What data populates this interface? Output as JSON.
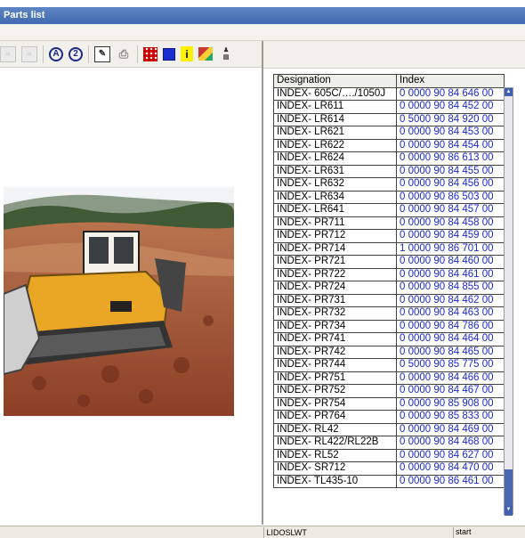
{
  "window": {
    "title": "Parts list"
  },
  "toolbar": {
    "icons": [
      "page-icon",
      "page-icon",
      "circle-a-icon",
      "circle-2-icon",
      "edit-icon",
      "print-icon",
      "grid-icon",
      "blue-square-icon",
      "info-icon",
      "book-icon",
      "library-icon"
    ],
    "circle_a": "A",
    "circle_2": "2",
    "info": "i"
  },
  "table": {
    "headers": [
      "Designation",
      "Index"
    ],
    "rows": [
      [
        "INDEX- 605C/…./1050J",
        "0 0000  90 84 646 00"
      ],
      [
        "INDEX- LR611",
        "0 0000  90 84 452 00"
      ],
      [
        "INDEX- LR614",
        "0 5000  90 84 920 00"
      ],
      [
        "INDEX- LR621",
        "0 0000  90 84 453 00"
      ],
      [
        "INDEX- LR622",
        "0 0000  90 84 454 00"
      ],
      [
        "INDEX- LR624",
        "0 0000  90 86 613 00"
      ],
      [
        "INDEX- LR631",
        "0 0000  90 84 455 00"
      ],
      [
        "INDEX- LR632",
        "0 0000  90 84 456 00"
      ],
      [
        "INDEX- LR634",
        "0 0000  90 86 503 00"
      ],
      [
        "INDEX- LR641",
        "0 0000  90 84 457 00"
      ],
      [
        "INDEX- PR711",
        "0 0000  90 84 458 00"
      ],
      [
        "INDEX- PR712",
        "0 0000  90 84 459 00"
      ],
      [
        "INDEX- PR714",
        "1 0000  90 86 701 00"
      ],
      [
        "INDEX- PR721",
        "0 0000  90 84 460 00"
      ],
      [
        "INDEX- PR722",
        "0 0000  90 84 461 00"
      ],
      [
        "INDEX- PR724",
        "0 0000  90 84 855 00"
      ],
      [
        "INDEX- PR731",
        "0 0000  90 84 462 00"
      ],
      [
        "INDEX- PR732",
        "0 0000  90 84 463 00"
      ],
      [
        "INDEX- PR734",
        "0 0000  90 84 786 00"
      ],
      [
        "INDEX- PR741",
        "0 0000  90 84 464 00"
      ],
      [
        "INDEX- PR742",
        "0 0000  90 84 465 00"
      ],
      [
        "INDEX- PR744",
        "0 5000  90 85 775 00"
      ],
      [
        "INDEX- PR751",
        "0 0000  90 84 466 00"
      ],
      [
        "INDEX- PR752",
        "0 0000  90 84 467 00"
      ],
      [
        "INDEX- PR754",
        "0 0000  90 85 908 00"
      ],
      [
        "INDEX- PR764",
        "0 0000  90 85 833 00"
      ],
      [
        "INDEX- RL42",
        "0 0000  90 84 469 00"
      ],
      [
        "INDEX- RL422/RL22B",
        "0 0000  90 84 468 00"
      ],
      [
        "INDEX- RL52",
        "0 0000  90 84 627 00"
      ],
      [
        "INDEX- SR712",
        "0 0000  90 84 470 00"
      ],
      [
        "INDEX- TL435-10",
        "0 0000  90 86 461 00"
      ]
    ]
  },
  "status": {
    "app": "LIDOSLWT",
    "right": "start"
  },
  "colors": {
    "title_bar": "#4a74b8",
    "index_text": "#1a2acc",
    "scroll_thumb": "#4a66b2"
  }
}
